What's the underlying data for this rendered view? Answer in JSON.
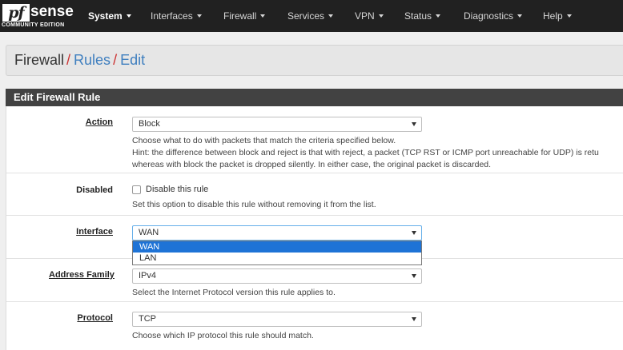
{
  "brand": {
    "logo_mark": "pf",
    "logo_text": "sense",
    "edition": "COMMUNITY EDITION"
  },
  "nav": {
    "items": [
      {
        "label": "System",
        "active": true
      },
      {
        "label": "Interfaces",
        "active": false
      },
      {
        "label": "Firewall",
        "active": false
      },
      {
        "label": "Services",
        "active": false
      },
      {
        "label": "VPN",
        "active": false
      },
      {
        "label": "Status",
        "active": false
      },
      {
        "label": "Diagnostics",
        "active": false
      },
      {
        "label": "Help",
        "active": false
      }
    ]
  },
  "breadcrumb": {
    "items": [
      "Firewall",
      "Rules",
      "Edit"
    ],
    "separator": "/"
  },
  "panel": {
    "title": "Edit Firewall Rule"
  },
  "form": {
    "action": {
      "label": "Action",
      "value": "Block",
      "help": [
        "Choose what to do with packets that match the criteria specified below.",
        "Hint: the difference between block and reject is that with reject, a packet (TCP RST or ICMP port unreachable for UDP) is retu",
        "whereas with block the packet is dropped silently. In either case, the original packet is discarded."
      ]
    },
    "disabled": {
      "label": "Disabled",
      "checkbox_label": "Disable this rule",
      "checked": false,
      "help": "Set this option to disable this rule without removing it from the list."
    },
    "interface": {
      "label": "Interface",
      "value": "WAN",
      "options": [
        "WAN",
        "LAN"
      ],
      "highlighted_option": "WAN"
    },
    "address_family": {
      "label": "Address Family",
      "value": "IPv4",
      "help": "Select the Internet Protocol version this rule applies to."
    },
    "protocol": {
      "label": "Protocol",
      "value": "TCP",
      "help": "Choose which IP protocol this rule should match."
    }
  },
  "colors": {
    "navbar": "#212121",
    "panel_heading": "#424242",
    "link": "#3f7fbf",
    "separator": "#cc3333",
    "option_highlight": "#1e73d6"
  }
}
